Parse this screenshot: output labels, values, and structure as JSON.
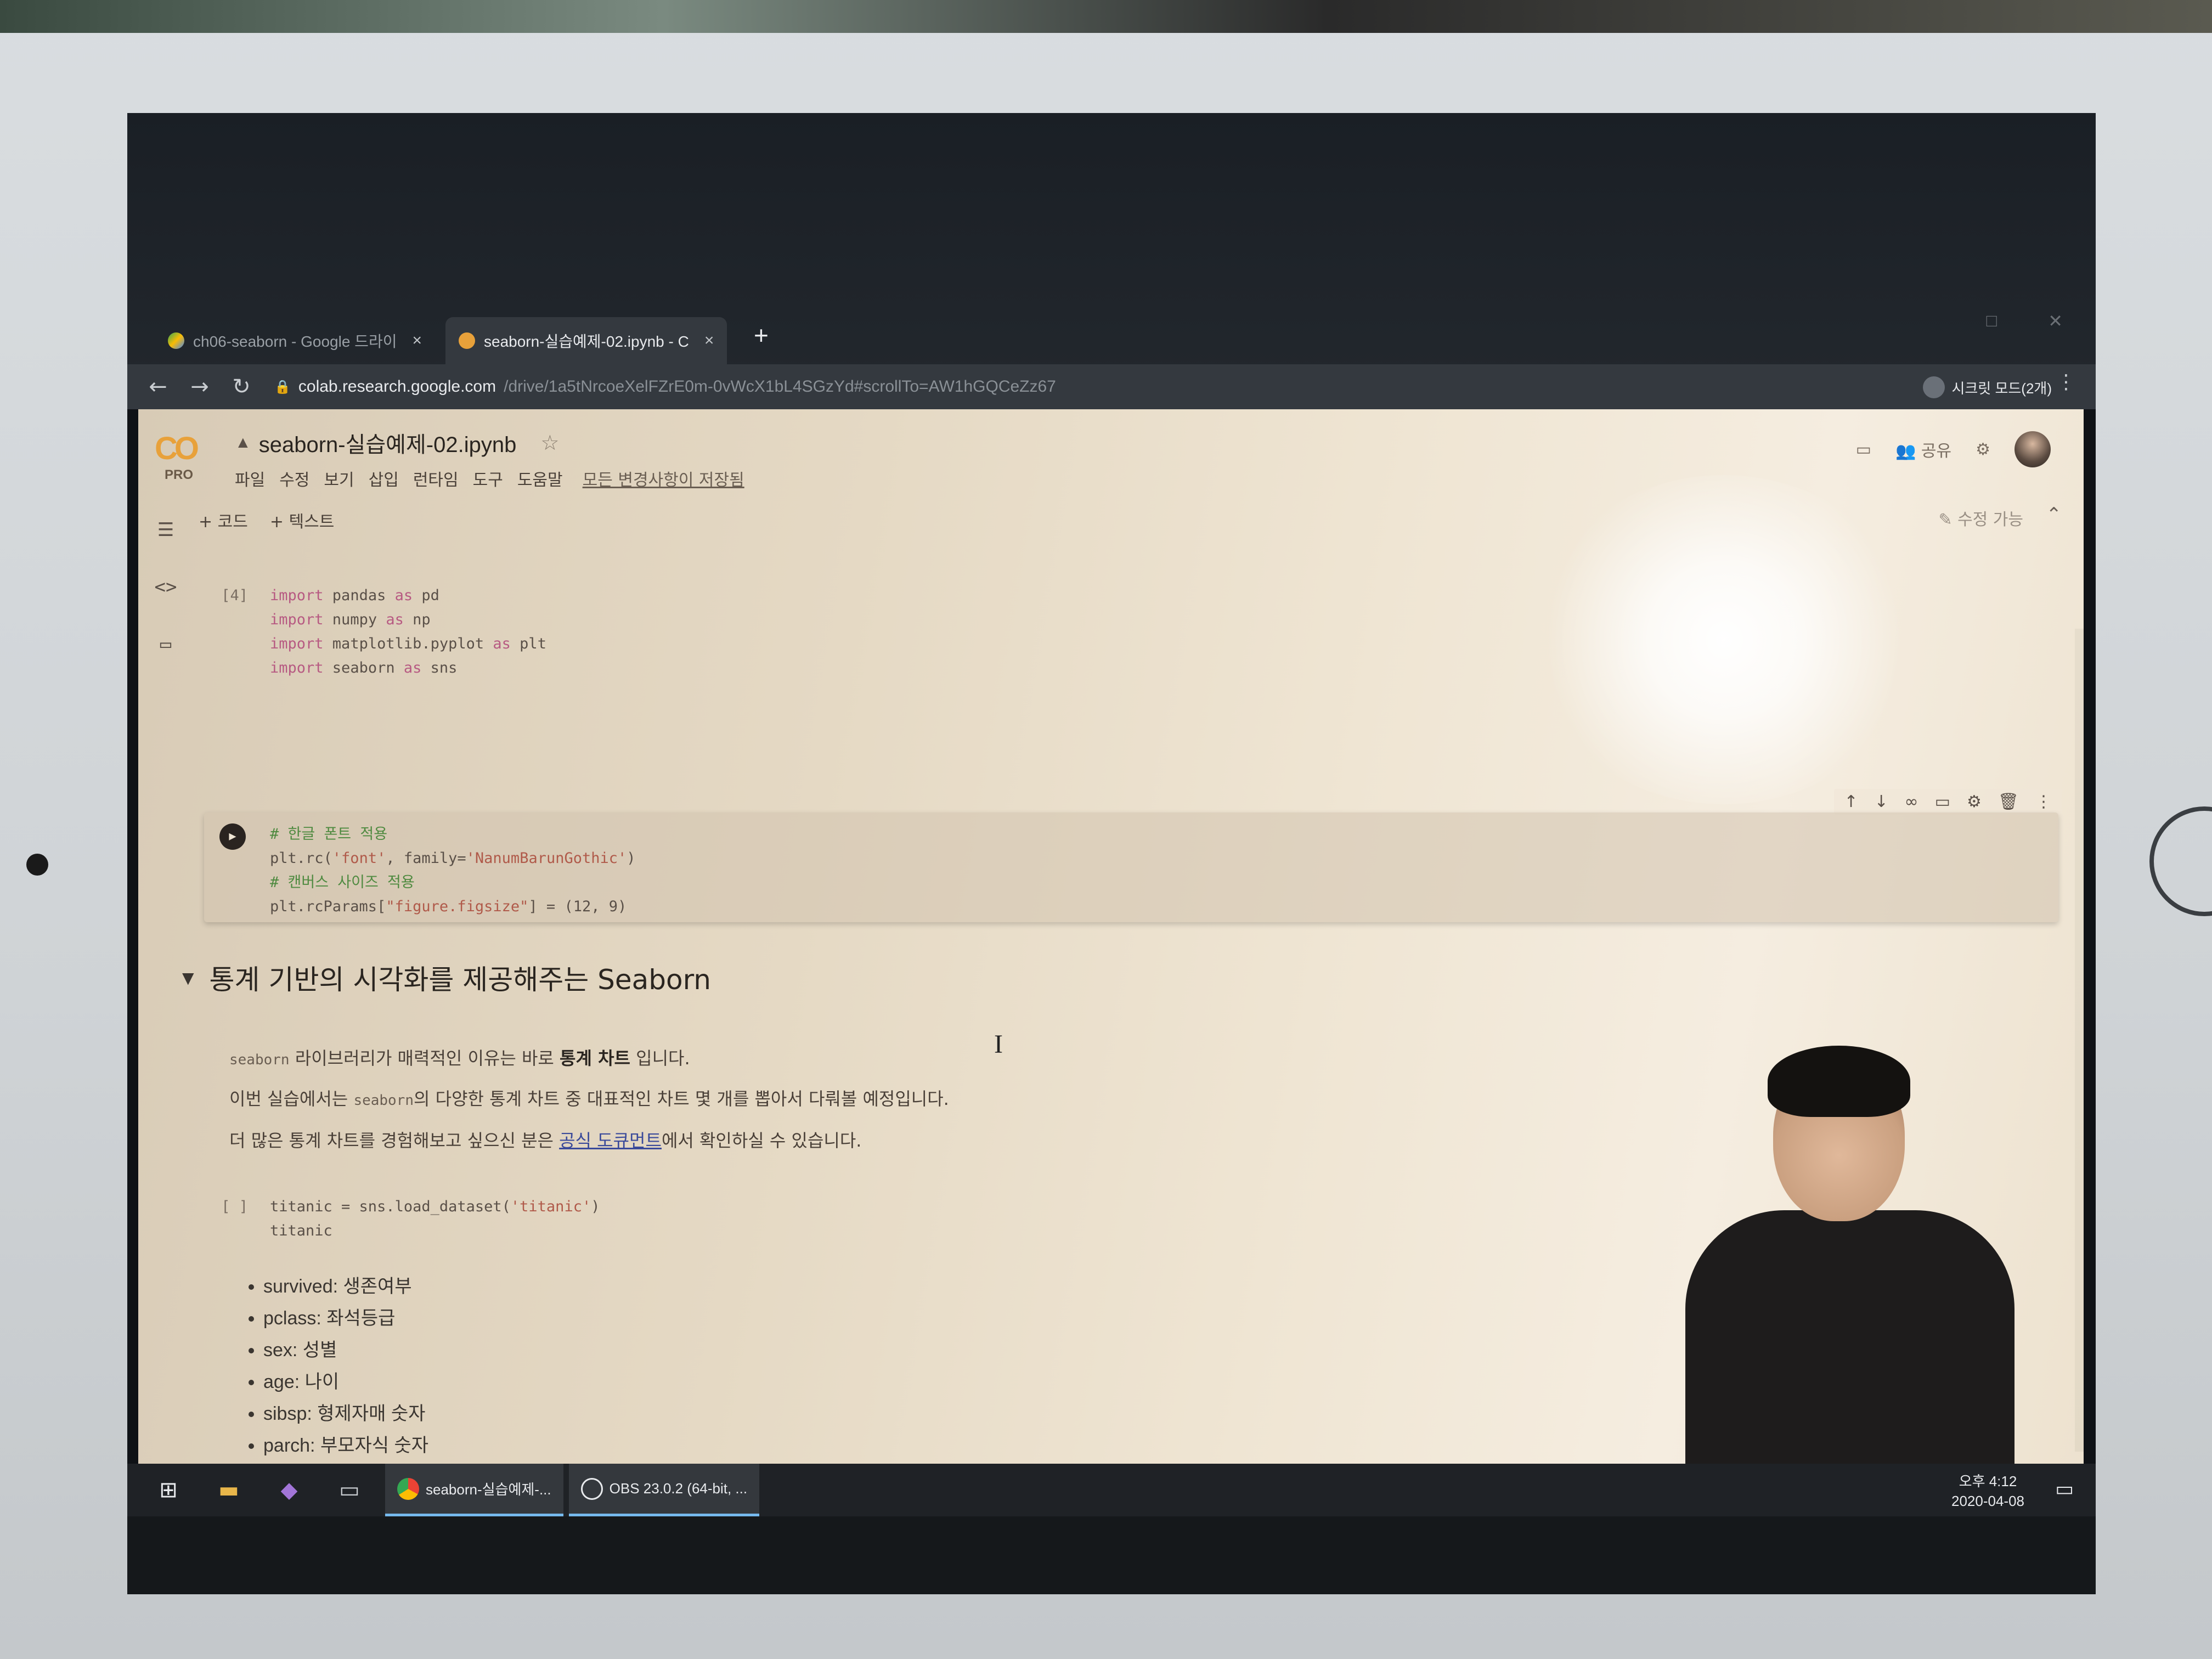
{
  "browser": {
    "tabs": [
      {
        "label": "ch06-seaborn - Google 드라이",
        "active": false,
        "icon": "google-drive-icon"
      },
      {
        "label": "seaborn-실습예제-02.ipynb - C",
        "active": true,
        "icon": "colab-icon"
      }
    ],
    "close_glyph": "×",
    "new_tab_glyph": "+",
    "url_host": "colab.research.google.com",
    "url_path": "/drive/1a5tNrcoeXelFZrE0m-0vWcX1bL4SGzYd#scrollTo=AW1hGQCeZz67",
    "profile_label": "시크릿 모드(2개)"
  },
  "colab": {
    "logo": "CO",
    "pro_badge": "PRO",
    "notebook_title": "seaborn-실습예제-02.ipynb",
    "menu": [
      "파일",
      "수정",
      "보기",
      "삽입",
      "런타임",
      "도구",
      "도움말"
    ],
    "save_status": "모든 변경사항이 저장됨",
    "share_label": "공유",
    "add_code": "+ 코드",
    "add_text": "+ 텍스트",
    "edit_mode": "수정 가능"
  },
  "cells": {
    "cell1": {
      "exec_count": "[4]",
      "lines": [
        {
          "kw": "import",
          "rest": " pandas ",
          "kw2": "as",
          "tail": " pd"
        },
        {
          "kw": "import",
          "rest": " numpy ",
          "kw2": "as",
          "tail": " np"
        },
        {
          "kw": "import",
          "rest": " matplotlib.pyplot ",
          "kw2": "as",
          "tail": " plt"
        },
        {
          "kw": "import",
          "rest": " seaborn ",
          "kw2": "as",
          "tail": " sns"
        }
      ]
    },
    "cell2": {
      "line1": "# 한글 폰트 적용",
      "line2_a": "plt.rc(",
      "line2_b": "'font'",
      "line2_c": ", family=",
      "line2_d": "'NanumBarunGothic'",
      "line2_e": ")",
      "line3": "# 캔버스 사이즈 적용",
      "line4_a": "plt.rcParams[",
      "line4_b": "\"figure.figsize\"",
      "line4_c": "] = (12, 9)"
    },
    "cell3": {
      "exec_count": "[ ]",
      "line1_a": "titanic = sns.load_dataset(",
      "line1_b": "'titanic'",
      "line1_c": ")",
      "line2": "titanic"
    }
  },
  "section": {
    "title": "통계 기반의 시각화를 제공해주는 Seaborn",
    "p1_code": "seaborn",
    "p1_text": " 라이브러리가 매력적인 이유는 바로 ",
    "p1_bold": "통계 차트",
    "p1_end": " 입니다.",
    "p2_start": "이번 실습에서는 ",
    "p2_code": "seaborn",
    "p2_end": "의 다양한 통계 차트 중 대표적인 차트 몇 개를 뽑아서 다뤄볼 예정입니다.",
    "p3_start": "더 많은 통계 차트를 경험해보고 싶으신 분은 ",
    "p3_link": "공식 도큐먼트",
    "p3_end": "에서 확인하실 수 있습니다.",
    "bullets": [
      "survived: 생존여부",
      "pclass: 좌석등급",
      "sex: 성별",
      "age: 나이",
      "sibsp: 형제자매 숫자",
      "parch: 부모자식 숫자"
    ]
  },
  "taskbar": {
    "chrome_task": "seaborn-실습예제-...",
    "obs_task": "OBS 23.0.2 (64-bit, ...",
    "time": "오후 4:12",
    "date": "2020-04-08"
  }
}
